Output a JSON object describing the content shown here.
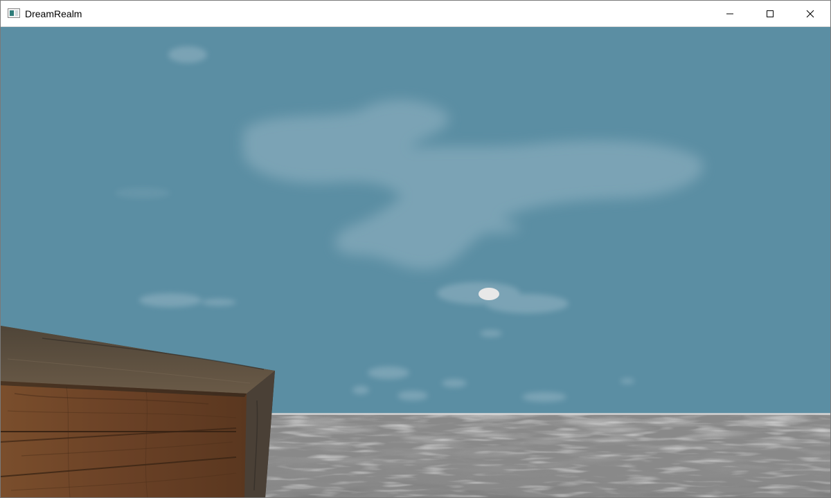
{
  "window": {
    "title": "DreamRealm",
    "app_icon": "window-app-icon",
    "controls": [
      {
        "name": "minimize",
        "icon": "minimize-icon"
      },
      {
        "name": "maximize",
        "icon": "maximize-icon"
      },
      {
        "name": "close",
        "icon": "close-icon"
      }
    ]
  },
  "scene": {
    "sky_color": "#5b8ea3",
    "cloud_color": "#7fa6b7",
    "sun_color": "#e8e8e8",
    "water_color": "#8e8e8e",
    "crate_color": "#6b4a30"
  }
}
